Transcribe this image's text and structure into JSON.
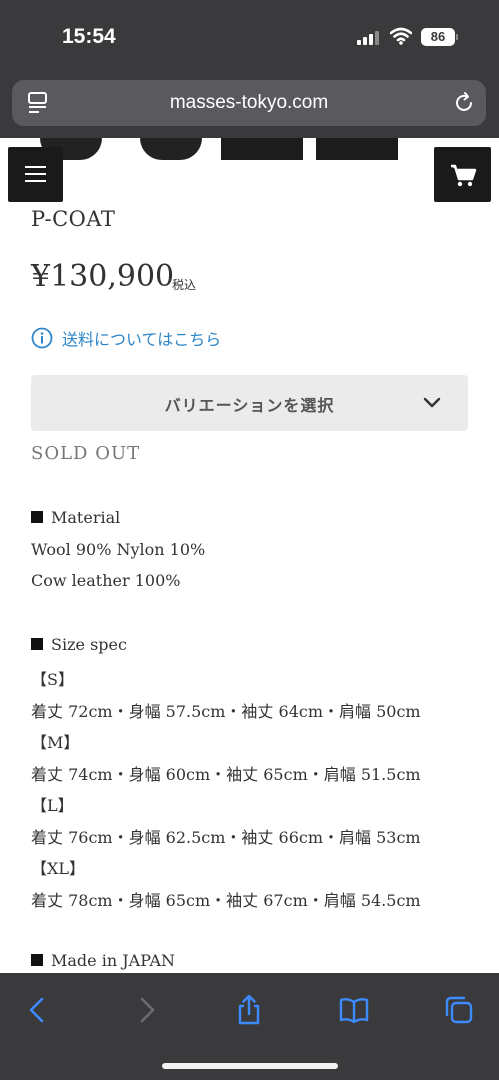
{
  "status": {
    "time": "15:54",
    "battery": "86"
  },
  "browser": {
    "url": "masses-tokyo.com"
  },
  "product": {
    "name": "P-COAT",
    "price": "¥130,900",
    "tax_label": "税込",
    "shipping_link": "送料についてはこちら",
    "variation_select": "バリエーションを選択",
    "status": "SOLD OUT"
  },
  "description": {
    "material_heading": "Material",
    "material_lines": [
      "Wool 90% Nylon 10%",
      "Cow leather 100%"
    ],
    "size_heading": "Size spec",
    "sizes": [
      {
        "label": "【S】",
        "spec": "着丈 72cm・身幅 57.5cm・袖丈 64cm・肩幅 50cm"
      },
      {
        "label": "【M】",
        "spec": "着丈 74cm・身幅 60cm・袖丈 65cm・肩幅 51.5cm"
      },
      {
        "label": "【L】",
        "spec": "着丈 76cm・身幅 62.5cm・袖丈 66cm・肩幅 53cm"
      },
      {
        "label": "【XL】",
        "spec": "着丈 78cm・身幅 65cm・袖丈 67cm・肩幅 54.5cm"
      }
    ],
    "made_in": "Made in JAPAN"
  },
  "colors": {
    "chrome_bg": "#3a3a3c",
    "link_blue": "#2f86c9",
    "toolbar_blue": "#3d8bff",
    "button_dark": "#1a1a1a"
  },
  "icons": {
    "menu": "hamburger-icon",
    "cart": "cart-icon",
    "info": "info-icon",
    "chevron": "chevron-down-icon",
    "back": "back-arrow-icon",
    "forward": "forward-arrow-icon",
    "share": "share-icon",
    "bookmarks": "bookmarks-icon",
    "tabs": "tabs-icon",
    "reader": "reader-icon",
    "reload": "reload-icon"
  }
}
